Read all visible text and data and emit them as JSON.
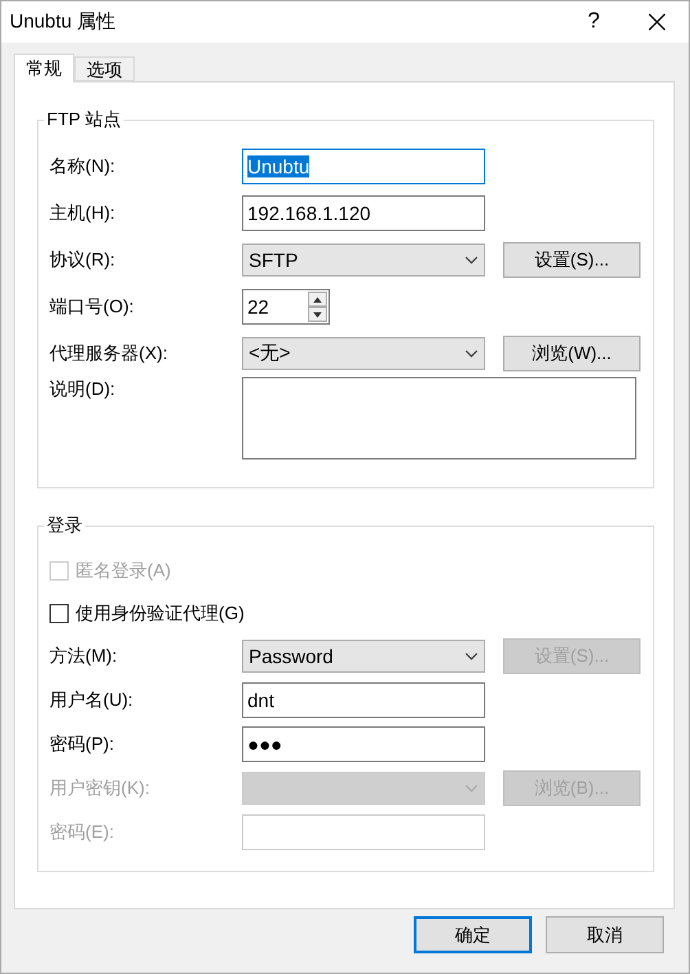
{
  "window": {
    "title": "Unubtu 属性",
    "help": "?"
  },
  "tabs": [
    {
      "label": "常规",
      "selected": true
    },
    {
      "label": "选项",
      "selected": false
    }
  ],
  "groups": [
    {
      "title": "FTP 站点",
      "rows": [
        {
          "kind": "text",
          "label": "名称(N):",
          "value": "Unubtu",
          "highlighted": true,
          "disabled": false
        },
        {
          "kind": "text",
          "label": "主机(H):",
          "value": "192.168.1.120",
          "highlighted": false,
          "disabled": false
        },
        {
          "kind": "select",
          "label": "协议(R):",
          "value": "SFTP",
          "disabled": false,
          "button": {
            "label": "设置(S)...",
            "disabled": false
          }
        },
        {
          "kind": "spin",
          "label": "端口号(O):",
          "value": "22"
        },
        {
          "kind": "select",
          "label": "代理服务器(X):",
          "value": "<无>",
          "disabled": false,
          "button": {
            "label": "浏览(W)...",
            "disabled": false
          }
        },
        {
          "kind": "textarea",
          "label": "说明(D):"
        }
      ]
    },
    {
      "title": "登录",
      "rows": [
        {
          "kind": "checkbox",
          "label": "匿名登录(A)",
          "checked": false,
          "disabled": true
        },
        {
          "kind": "checkbox",
          "label": "使用身份验证代理(G)",
          "checked": false,
          "disabled": false
        },
        {
          "kind": "select",
          "label": "方法(M):",
          "value": "Password",
          "disabled": false,
          "button": {
            "label": "设置(S)...",
            "disabled": true
          }
        },
        {
          "kind": "text",
          "label": "用户名(U):",
          "value": "dnt",
          "highlighted": false,
          "disabled": false
        },
        {
          "kind": "text",
          "label": "密码(P):",
          "value": "●●●",
          "highlighted": false,
          "disabled": false
        },
        {
          "kind": "select",
          "label": "用户密钥(K):",
          "disabled": true,
          "button": {
            "label": "浏览(B)...",
            "disabled": true
          }
        },
        {
          "kind": "text",
          "label": "密码(E):",
          "highlighted": false,
          "disabled": true
        }
      ]
    }
  ],
  "buttons": [
    {
      "label": "确定",
      "default": true
    },
    {
      "label": "取消",
      "default": false
    }
  ]
}
